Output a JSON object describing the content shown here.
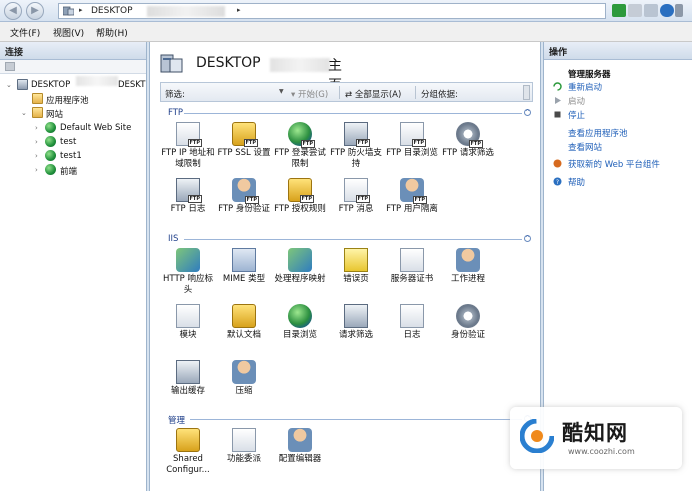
{
  "address_bar": {
    "crumb": "DESKTOP",
    "arrow": "▸"
  },
  "menu": [
    "文件(F)",
    "视图(V)",
    "帮助(H)"
  ],
  "connections": {
    "title": "连接",
    "tree": {
      "server": "DESKTOP",
      "server_suffix": "DESKT",
      "app_pools": "应用程序池",
      "sites": "网站",
      "site_items": [
        "Default Web Site",
        "test",
        "test1",
        "前端"
      ]
    }
  },
  "center": {
    "title_prefix": "DESKTOP",
    "title_suffix": "主页",
    "filter": {
      "label": "筛选:",
      "value": "",
      "go": "开始(G)",
      "show_all": "全部显示(A)",
      "group_by": "分组依据:"
    },
    "groups": [
      {
        "name": "FTP",
        "items": [
          {
            "label": "FTP IP 地址和域限制",
            "icon": "ip-restriction-icon"
          },
          {
            "label": "FTP SSL 设置",
            "icon": "ssl-lock-icon"
          },
          {
            "label": "FTP 登录尝试限制",
            "icon": "logon-attempt-icon"
          },
          {
            "label": "FTP 防火墙支持",
            "icon": "firewall-icon"
          },
          {
            "label": "FTP 目录浏览",
            "icon": "directory-browse-icon"
          },
          {
            "label": "FTP 请求筛选",
            "icon": "request-filter-icon"
          },
          {
            "label": "FTP 日志",
            "icon": "log-icon"
          },
          {
            "label": "FTP 身份验证",
            "icon": "authentication-icon"
          },
          {
            "label": "FTP 授权规则",
            "icon": "authorization-icon"
          },
          {
            "label": "FTP 消息",
            "icon": "message-icon"
          },
          {
            "label": "FTP 用户隔离",
            "icon": "user-isolation-icon"
          }
        ]
      },
      {
        "name": "IIS",
        "items": [
          {
            "label": "HTTP 响应标头",
            "icon": "response-headers-icon"
          },
          {
            "label": "MIME 类型",
            "icon": "mime-icon"
          },
          {
            "label": "处理程序映射",
            "icon": "handler-mapping-icon"
          },
          {
            "label": "错误页",
            "icon": "error-page-icon"
          },
          {
            "label": "服务器证书",
            "icon": "certificate-icon"
          },
          {
            "label": "工作进程",
            "icon": "worker-process-icon"
          },
          {
            "label": "模块",
            "icon": "modules-icon"
          },
          {
            "label": "默认文档",
            "icon": "default-document-icon"
          },
          {
            "label": "目录浏览",
            "icon": "directory-browse-icon"
          },
          {
            "label": "请求筛选",
            "icon": "request-filter-icon"
          },
          {
            "label": "日志",
            "icon": "log-icon"
          },
          {
            "label": "身份验证",
            "icon": "authentication-icon"
          },
          {
            "label": "输出缓存",
            "icon": "output-cache-icon"
          },
          {
            "label": "压缩",
            "icon": "compression-icon"
          }
        ]
      },
      {
        "name": "管理",
        "items": [
          {
            "label": "Shared Configur...",
            "icon": "shared-config-icon"
          },
          {
            "label": "功能委派",
            "icon": "feature-delegation-icon"
          },
          {
            "label": "配置编辑器",
            "icon": "config-editor-icon"
          }
        ]
      }
    ]
  },
  "actions": {
    "title": "操作",
    "group_title": "管理服务器",
    "items": [
      {
        "label": "重新启动",
        "enabled": true
      },
      {
        "label": "启动",
        "enabled": false
      },
      {
        "label": "停止",
        "enabled": true
      },
      {
        "label": "查看应用程序池",
        "enabled": true
      },
      {
        "label": "查看网站",
        "enabled": true
      },
      {
        "label": "获取新的 Web 平台组件",
        "enabled": true
      },
      {
        "label": "帮助",
        "enabled": true
      }
    ]
  },
  "watermark": {
    "text": "酷知网",
    "url": "www.coozhi.com"
  }
}
